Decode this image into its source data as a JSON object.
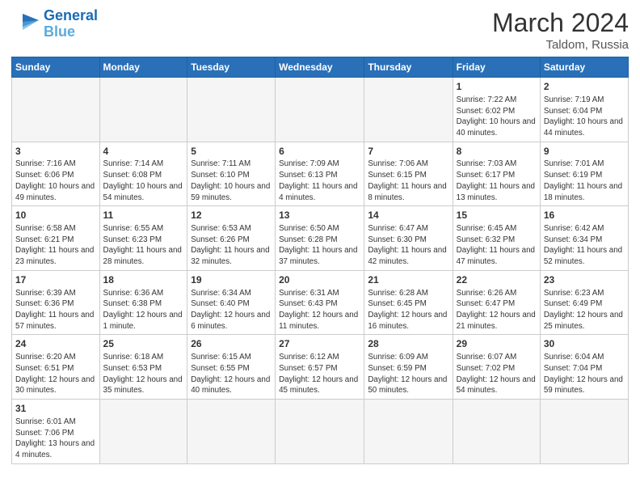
{
  "header": {
    "logo_general": "General",
    "logo_blue": "Blue",
    "month_year": "March 2024",
    "location": "Taldom, Russia"
  },
  "weekdays": [
    "Sunday",
    "Monday",
    "Tuesday",
    "Wednesday",
    "Thursday",
    "Friday",
    "Saturday"
  ],
  "weeks": [
    [
      {
        "day": "",
        "info": ""
      },
      {
        "day": "",
        "info": ""
      },
      {
        "day": "",
        "info": ""
      },
      {
        "day": "",
        "info": ""
      },
      {
        "day": "",
        "info": ""
      },
      {
        "day": "1",
        "info": "Sunrise: 7:22 AM\nSunset: 6:02 PM\nDaylight: 10 hours and 40 minutes."
      },
      {
        "day": "2",
        "info": "Sunrise: 7:19 AM\nSunset: 6:04 PM\nDaylight: 10 hours and 44 minutes."
      }
    ],
    [
      {
        "day": "3",
        "info": "Sunrise: 7:16 AM\nSunset: 6:06 PM\nDaylight: 10 hours and 49 minutes."
      },
      {
        "day": "4",
        "info": "Sunrise: 7:14 AM\nSunset: 6:08 PM\nDaylight: 10 hours and 54 minutes."
      },
      {
        "day": "5",
        "info": "Sunrise: 7:11 AM\nSunset: 6:10 PM\nDaylight: 10 hours and 59 minutes."
      },
      {
        "day": "6",
        "info": "Sunrise: 7:09 AM\nSunset: 6:13 PM\nDaylight: 11 hours and 4 minutes."
      },
      {
        "day": "7",
        "info": "Sunrise: 7:06 AM\nSunset: 6:15 PM\nDaylight: 11 hours and 8 minutes."
      },
      {
        "day": "8",
        "info": "Sunrise: 7:03 AM\nSunset: 6:17 PM\nDaylight: 11 hours and 13 minutes."
      },
      {
        "day": "9",
        "info": "Sunrise: 7:01 AM\nSunset: 6:19 PM\nDaylight: 11 hours and 18 minutes."
      }
    ],
    [
      {
        "day": "10",
        "info": "Sunrise: 6:58 AM\nSunset: 6:21 PM\nDaylight: 11 hours and 23 minutes."
      },
      {
        "day": "11",
        "info": "Sunrise: 6:55 AM\nSunset: 6:23 PM\nDaylight: 11 hours and 28 minutes."
      },
      {
        "day": "12",
        "info": "Sunrise: 6:53 AM\nSunset: 6:26 PM\nDaylight: 11 hours and 32 minutes."
      },
      {
        "day": "13",
        "info": "Sunrise: 6:50 AM\nSunset: 6:28 PM\nDaylight: 11 hours and 37 minutes."
      },
      {
        "day": "14",
        "info": "Sunrise: 6:47 AM\nSunset: 6:30 PM\nDaylight: 11 hours and 42 minutes."
      },
      {
        "day": "15",
        "info": "Sunrise: 6:45 AM\nSunset: 6:32 PM\nDaylight: 11 hours and 47 minutes."
      },
      {
        "day": "16",
        "info": "Sunrise: 6:42 AM\nSunset: 6:34 PM\nDaylight: 11 hours and 52 minutes."
      }
    ],
    [
      {
        "day": "17",
        "info": "Sunrise: 6:39 AM\nSunset: 6:36 PM\nDaylight: 11 hours and 57 minutes."
      },
      {
        "day": "18",
        "info": "Sunrise: 6:36 AM\nSunset: 6:38 PM\nDaylight: 12 hours and 1 minute."
      },
      {
        "day": "19",
        "info": "Sunrise: 6:34 AM\nSunset: 6:40 PM\nDaylight: 12 hours and 6 minutes."
      },
      {
        "day": "20",
        "info": "Sunrise: 6:31 AM\nSunset: 6:43 PM\nDaylight: 12 hours and 11 minutes."
      },
      {
        "day": "21",
        "info": "Sunrise: 6:28 AM\nSunset: 6:45 PM\nDaylight: 12 hours and 16 minutes."
      },
      {
        "day": "22",
        "info": "Sunrise: 6:26 AM\nSunset: 6:47 PM\nDaylight: 12 hours and 21 minutes."
      },
      {
        "day": "23",
        "info": "Sunrise: 6:23 AM\nSunset: 6:49 PM\nDaylight: 12 hours and 25 minutes."
      }
    ],
    [
      {
        "day": "24",
        "info": "Sunrise: 6:20 AM\nSunset: 6:51 PM\nDaylight: 12 hours and 30 minutes."
      },
      {
        "day": "25",
        "info": "Sunrise: 6:18 AM\nSunset: 6:53 PM\nDaylight: 12 hours and 35 minutes."
      },
      {
        "day": "26",
        "info": "Sunrise: 6:15 AM\nSunset: 6:55 PM\nDaylight: 12 hours and 40 minutes."
      },
      {
        "day": "27",
        "info": "Sunrise: 6:12 AM\nSunset: 6:57 PM\nDaylight: 12 hours and 45 minutes."
      },
      {
        "day": "28",
        "info": "Sunrise: 6:09 AM\nSunset: 6:59 PM\nDaylight: 12 hours and 50 minutes."
      },
      {
        "day": "29",
        "info": "Sunrise: 6:07 AM\nSunset: 7:02 PM\nDaylight: 12 hours and 54 minutes."
      },
      {
        "day": "30",
        "info": "Sunrise: 6:04 AM\nSunset: 7:04 PM\nDaylight: 12 hours and 59 minutes."
      }
    ],
    [
      {
        "day": "31",
        "info": "Sunrise: 6:01 AM\nSunset: 7:06 PM\nDaylight: 13 hours and 4 minutes."
      },
      {
        "day": "",
        "info": ""
      },
      {
        "day": "",
        "info": ""
      },
      {
        "day": "",
        "info": ""
      },
      {
        "day": "",
        "info": ""
      },
      {
        "day": "",
        "info": ""
      },
      {
        "day": "",
        "info": ""
      }
    ]
  ]
}
